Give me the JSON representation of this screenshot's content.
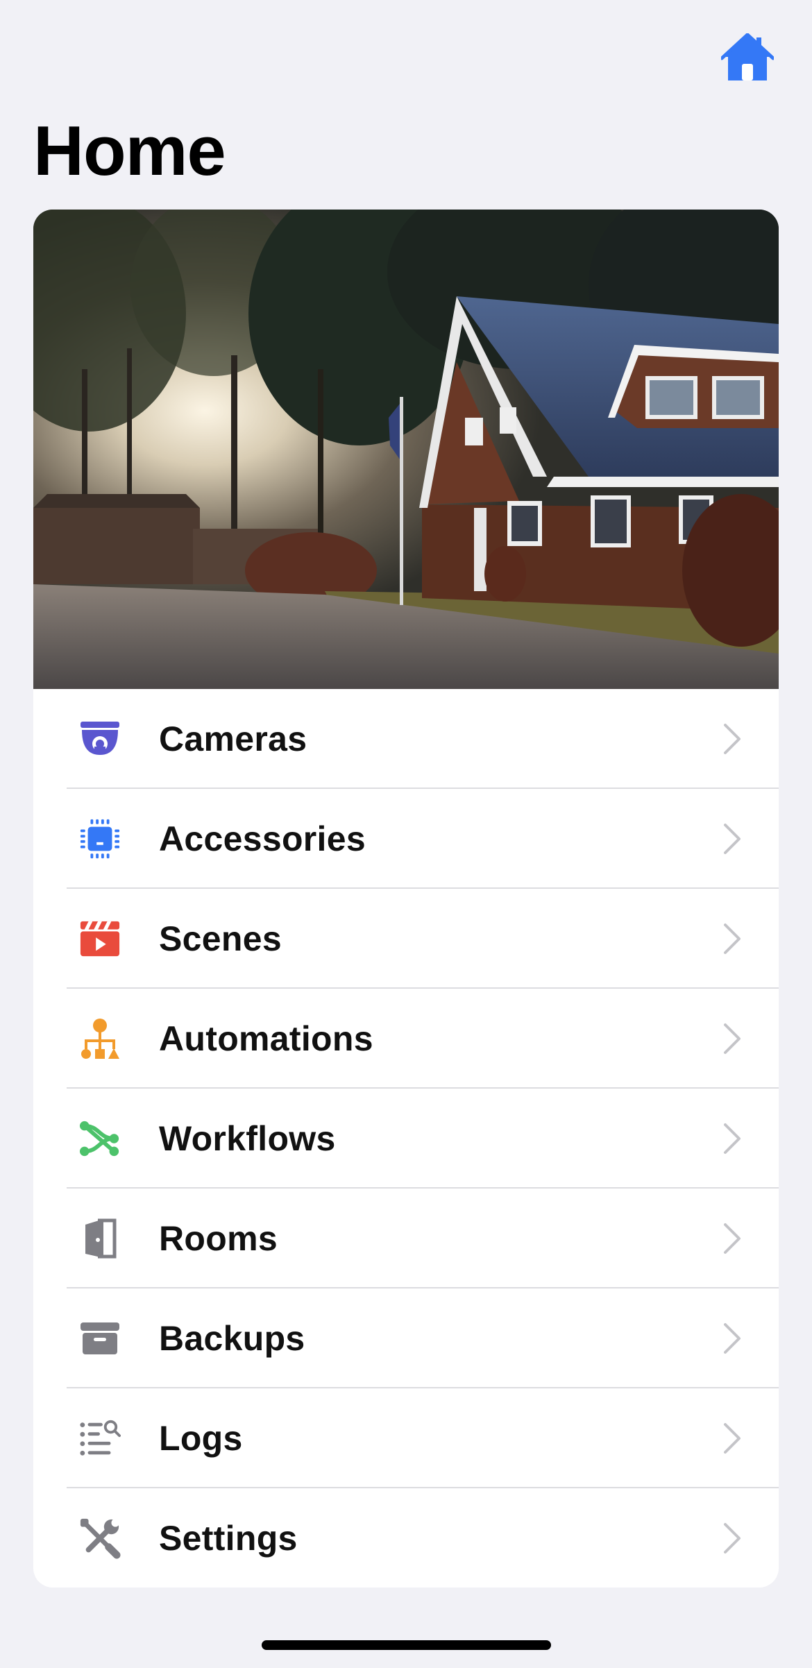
{
  "header": {
    "title": "Home",
    "home_icon": "house-fill-icon",
    "accent": "#3478f6"
  },
  "hero": {
    "subject": "house-photo"
  },
  "menu": {
    "items": [
      {
        "label": "Cameras",
        "icon": "security-camera-icon",
        "color": "#5a56cf"
      },
      {
        "label": "Accessories",
        "icon": "chip-icon",
        "color": "#3478f6"
      },
      {
        "label": "Scenes",
        "icon": "clapperboard-play-icon",
        "color": "#e94b3c"
      },
      {
        "label": "Automations",
        "icon": "hierarchy-shapes-icon",
        "color": "#f29b2c"
      },
      {
        "label": "Workflows",
        "icon": "share-nodes-icon",
        "color": "#4cc26a"
      },
      {
        "label": "Rooms",
        "icon": "door-open-icon",
        "color": "#7e7e84"
      },
      {
        "label": "Backups",
        "icon": "archive-box-icon",
        "color": "#7e7e84"
      },
      {
        "label": "Logs",
        "icon": "list-search-icon",
        "color": "#7e7e84"
      },
      {
        "label": "Settings",
        "icon": "wrench-screwdriver-icon",
        "color": "#7e7e84"
      }
    ]
  }
}
